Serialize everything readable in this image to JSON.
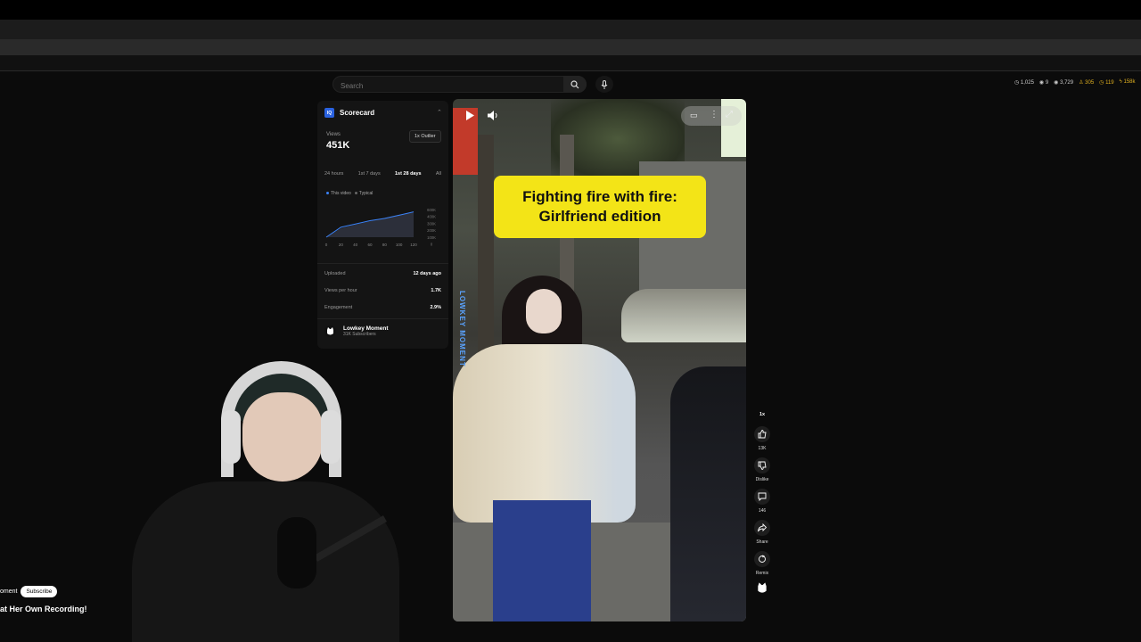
{
  "search": {
    "placeholder": "Search"
  },
  "stats": [
    {
      "value": "1,025",
      "icon": "clock-icon"
    },
    {
      "value": "9",
      "icon": "eye-icon"
    },
    {
      "value": "3,729",
      "icon": "eye-icon"
    },
    {
      "value": "305",
      "icon": "person-icon",
      "color": "#e0b020"
    },
    {
      "value": "119",
      "icon": "clock-icon",
      "color": "#e0b020"
    },
    {
      "value": "158k",
      "icon": "lightning-icon",
      "color": "#e0b020"
    }
  ],
  "scorecard": {
    "title": "Scorecard",
    "logo_text": "IQ",
    "views_label": "Views",
    "views_value": "451K",
    "outlier_badge": "1x Outlier",
    "tabs": [
      "24 hours",
      "1st 7 days",
      "1st 28 days",
      "All"
    ],
    "active_tab": "1st 28 days",
    "legend": [
      {
        "label": "This video",
        "color": "#3b82f6"
      },
      {
        "label": "Typical",
        "color": "#555555"
      }
    ],
    "chart_data": {
      "type": "line",
      "x": [
        0,
        20,
        40,
        60,
        80,
        100,
        120
      ],
      "x_tick_labels": [
        "0",
        "20",
        "40",
        "60",
        "80",
        "100",
        "120"
      ],
      "y_tick_labels": [
        "600K",
        "400K",
        "300K",
        "200K",
        "100K",
        "0"
      ],
      "series": [
        {
          "name": "This video",
          "values": [
            0,
            180000,
            240000,
            300000,
            340000,
            400000,
            460000
          ]
        },
        {
          "name": "Typical",
          "values": [
            0,
            160000,
            230000,
            290000,
            350000,
            410000,
            450000
          ]
        }
      ],
      "ylim": [
        0,
        600000
      ]
    },
    "rows": [
      {
        "key": "Uploaded",
        "value": "12 days ago"
      },
      {
        "key": "Views per hour",
        "value": "1.7K"
      },
      {
        "key": "Engagement",
        "value": "2.9%"
      }
    ],
    "channel_name": "Lowkey Moment",
    "channel_subs": "31K Subscribers"
  },
  "video": {
    "caption": "Fighting fire with fire: Girlfriend edition",
    "watermark": "LOWKEY MOMENT"
  },
  "actions": {
    "speed": "1x",
    "like_count": "13K",
    "dislike_label": "Dislike",
    "comment_count": "146",
    "share_label": "Share",
    "remix_label": "Remix"
  },
  "bottom": {
    "channel_partial": "oment",
    "subscribe_label": "Subscribe",
    "title_partial": "at Her Own Recording!"
  }
}
